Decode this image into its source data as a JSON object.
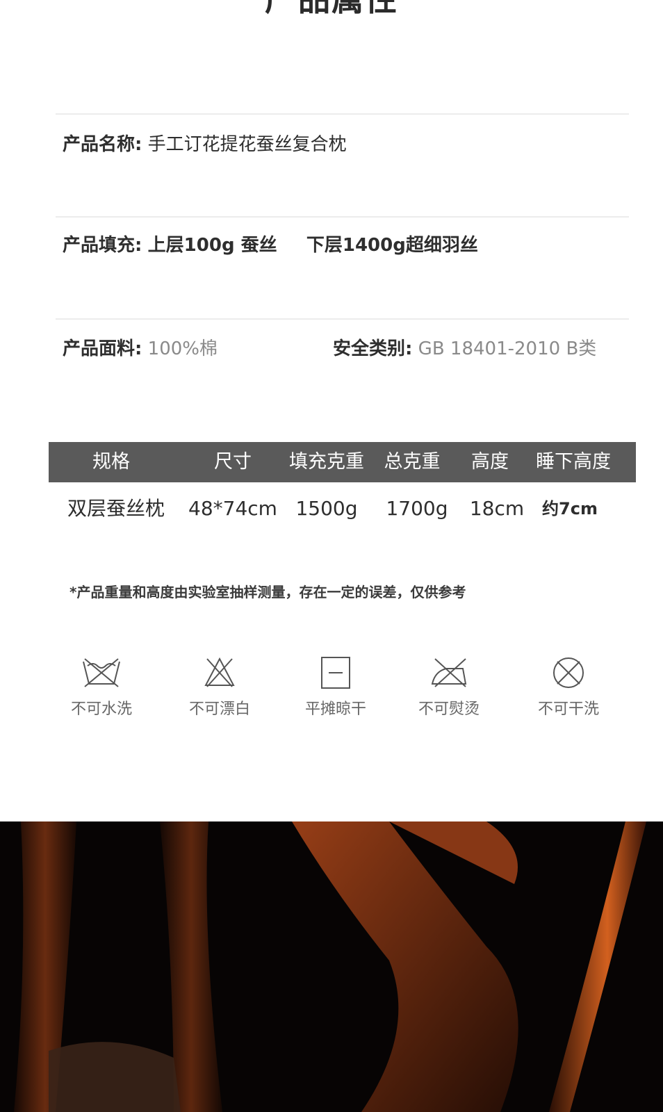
{
  "page_title": "产品属性",
  "attributes": {
    "name_label": "产品名称:",
    "name_value": "手工订花提花蚕丝复合枕",
    "fill_label": "产品填充:",
    "fill_upper": "上层100g 蚕丝",
    "fill_lower": "下层1400g超细羽丝",
    "fabric_label": "产品面料:",
    "fabric_value": "100%棉",
    "safety_label": "安全类别:",
    "safety_value": "GB 18401-2010 B类"
  },
  "spec_table": {
    "headers": [
      "规格",
      "尺寸",
      "填充克重",
      "总克重",
      "高度",
      "睡下高度"
    ],
    "rows": [
      [
        "双层蚕丝枕",
        "48*74cm",
        "1500g",
        "1700g",
        "18cm",
        "约7cm"
      ]
    ]
  },
  "note": "*产品重量和高度由实验室抽样测量，存在一定的误差，仅供参考",
  "care_icons": [
    {
      "icon": "no-wash-icon",
      "label": "不可水洗"
    },
    {
      "icon": "no-bleach-icon",
      "label": "不可漂白"
    },
    {
      "icon": "dry-flat-icon",
      "label": "平摊晾干"
    },
    {
      "icon": "no-iron-icon",
      "label": "不可熨烫"
    },
    {
      "icon": "no-dry-clean-icon",
      "label": "不可干洗"
    }
  ],
  "colors": {
    "header_bg": "#5a5a5a",
    "text_dark": "#2e2e2e",
    "text_grey": "#8a8a8a",
    "photo_accent": "#c4521c"
  }
}
